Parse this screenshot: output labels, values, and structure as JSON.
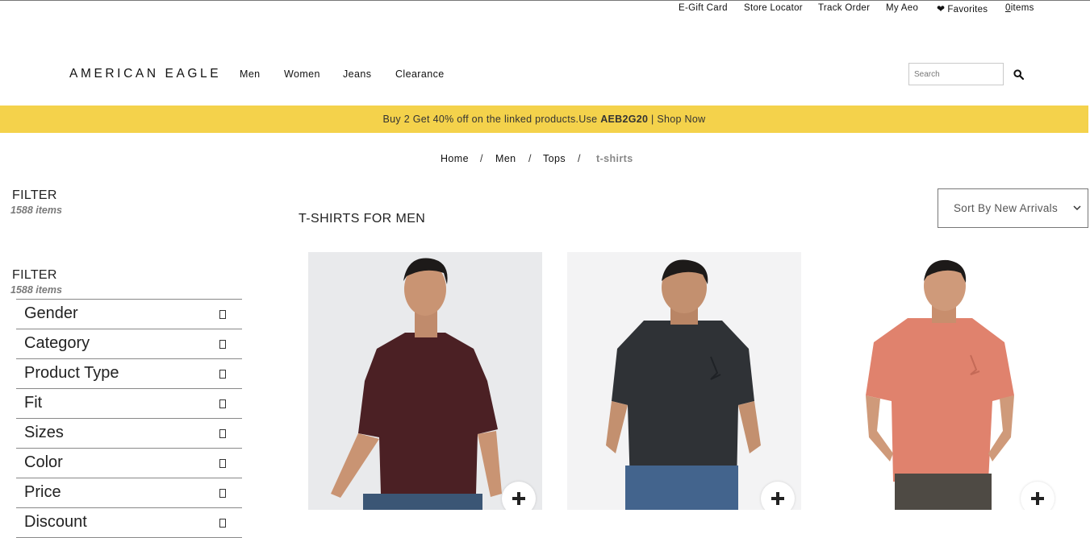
{
  "util_nav": {
    "gift_card": "E-Gift Card",
    "store_locator": "Store Locator",
    "track_order": "Track Order",
    "my_aeo": "My Aeo",
    "favorites": "Favorites",
    "cart_count": "0",
    "cart_label": "items"
  },
  "brand": {
    "name": "AMERICAN EAGLE"
  },
  "main_nav": [
    "Men",
    "Women",
    "Jeans",
    "Clearance"
  ],
  "search": {
    "placeholder": "Search"
  },
  "promo": {
    "text": "Buy 2 Get 40% off on the linked products.Use ",
    "code": "AEB2G20",
    "separator": " | ",
    "cta": "Shop Now",
    "color": "#f4d24b"
  },
  "breadcrumb": {
    "items": [
      "Home",
      "Men",
      "Tops"
    ],
    "current": "t-shirts",
    "separator": "/"
  },
  "filter": {
    "title": "FILTER",
    "count": "1588 items",
    "facets": [
      "Gender",
      "Category",
      "Product Type",
      "Fit",
      "Sizes",
      "Color",
      "Price",
      "Discount"
    ]
  },
  "page": {
    "title": "T-SHIRTS FOR MEN"
  },
  "sort": {
    "selected": "Sort By New Arrivals"
  },
  "products": [
    {
      "shirt_color": "#4b2024",
      "icon": "plus-icon"
    },
    {
      "shirt_color": "#2f3236",
      "icon": "plus-icon"
    },
    {
      "shirt_color": "#e0826d",
      "icon": "plus-icon"
    }
  ]
}
